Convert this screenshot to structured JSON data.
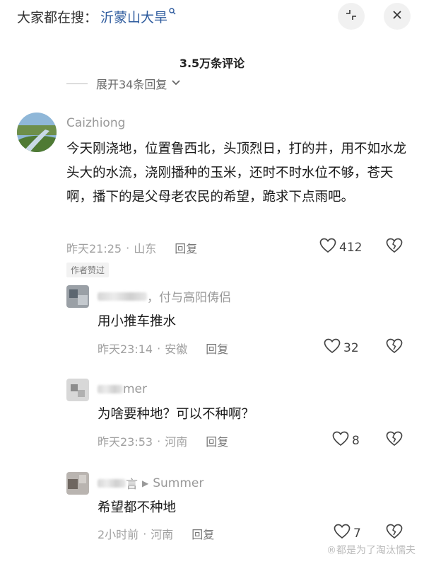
{
  "header": {
    "search_prefix": "大家都在搜：",
    "search_term": "沂蒙山大旱",
    "search_icon": "search-icon",
    "collapse_icon": "collapse-icon",
    "close_icon": "close-icon",
    "close_glyph": "✕",
    "collapse_glyph": "⤡"
  },
  "comments_count": "3.5万条评论",
  "expand_label": "展开34条回复",
  "main_comment": {
    "username": "Caizhiong",
    "text": "今天刚浇地，位置鲁西北，头顶烈日，打的井，用不如水龙头大的水流，浇刚播种的玉米，还时不时水位不够，苍天啊，播下的是父母老农民的希望，跪求下点雨吧。",
    "time": "昨天21:25",
    "sep": "·",
    "location": "山东",
    "reply_label": "回复",
    "likes": "412",
    "badge": "作者赞过"
  },
  "replies": [
    {
      "username_suffix": "，付与高阳俦侣",
      "text": "用小推车推水",
      "time": "昨天23:14",
      "sep": "·",
      "location": "安徽",
      "reply_label": "回复",
      "likes": "32"
    },
    {
      "username_suffix": "mer",
      "text": "为啥要种地？可以不种啊？",
      "time": "昨天23:53",
      "sep": "·",
      "location": "河南",
      "reply_label": "回复",
      "likes": "8"
    },
    {
      "username_suffix": "言",
      "reply_to_arrow": "▶",
      "reply_to": "Summer",
      "text": "希望都不种地",
      "time": "2小时前",
      "sep": "·",
      "location": "河南",
      "reply_label": "回复",
      "likes": "7"
    }
  ],
  "watermark": "®都是为了淘汰懦夫",
  "colors": {
    "link_blue": "#2f5c9e",
    "meta_gray": "#a0a0a0",
    "text": "#1a1a1a"
  }
}
